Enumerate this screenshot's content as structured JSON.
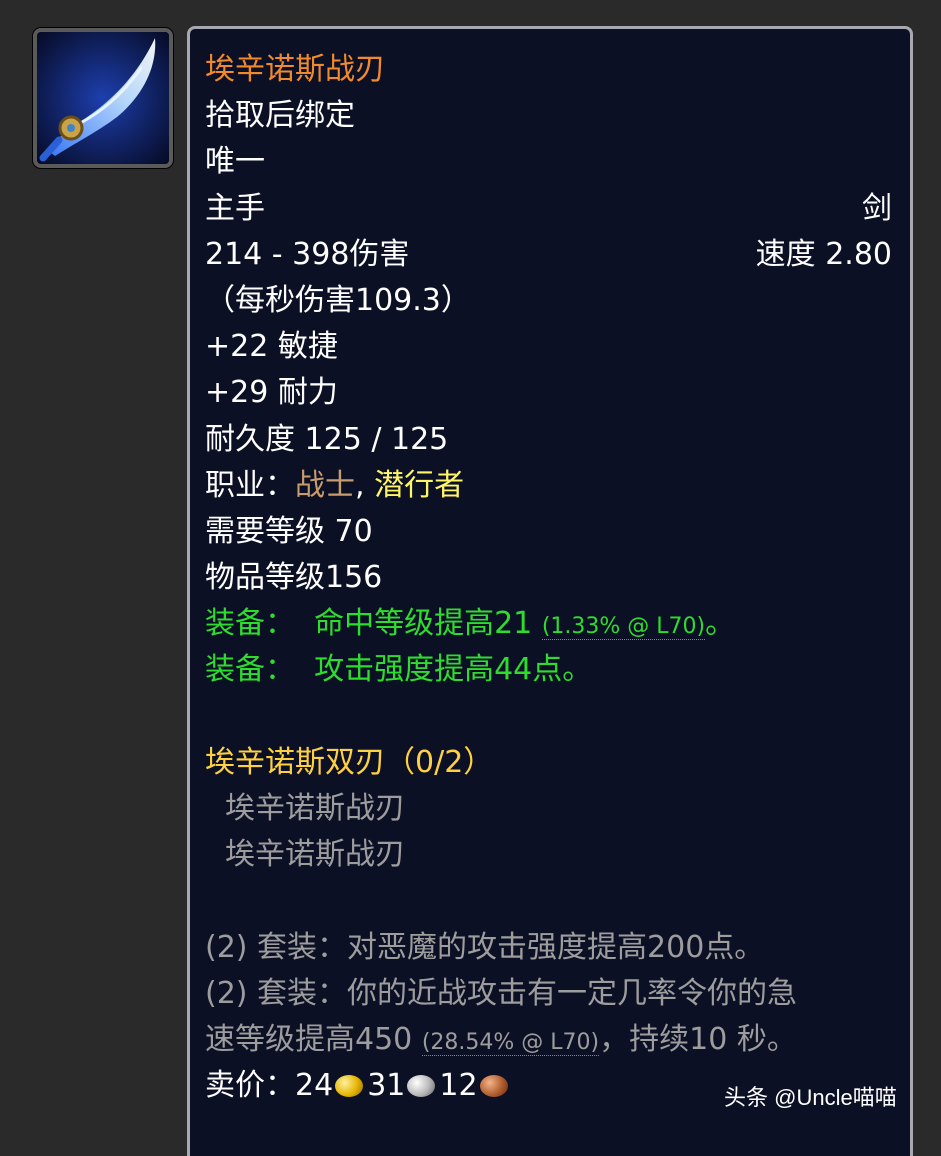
{
  "icon": {
    "name": "sword-icon"
  },
  "tooltip": {
    "title": "埃辛诺斯战刃",
    "bind": "拾取后绑定",
    "unique": "唯一",
    "slot": "主手",
    "weapon_type": "剑",
    "damage": "214 - 398伤害",
    "speed": "速度 2.80",
    "dps": "（每秒伤害109.3）",
    "agility": "+22 敏捷",
    "stamina": "+29 耐力",
    "durability": "耐久度 125 / 125",
    "classes_label": "职业：",
    "class_warrior": "战士",
    "class_separator": ", ",
    "class_rogue": "潜行者",
    "required_level": "需要等级 70",
    "item_level": "物品等级156",
    "equip1_prefix": "装备：",
    "equip1_text": "命中等级提高21",
    "equip1_note": "(1.33% @ L70)",
    "equip1_suffix": "。",
    "equip2_prefix": "装备：",
    "equip2_text": "攻击强度提高44点。",
    "set_name": "埃辛诺斯双刃（0/2）",
    "set_item1": "埃辛诺斯战刃",
    "set_item2": "埃辛诺斯战刃",
    "set_bonus1": "(2) 套装：对恶魔的攻击强度提高200点。",
    "set_bonus2_line1": "(2) 套装：你的近战攻击有一定几率令你的急",
    "set_bonus2_line2_a": "速等级提高450",
    "set_bonus2_note": "(28.54% @ L70)",
    "set_bonus2_line2_b": "，持续10 秒。",
    "sell_label": "卖价：",
    "sell_gold": "24",
    "sell_silver": "31",
    "sell_copper": "12"
  },
  "watermark": "头条 @Uncle喵喵"
}
